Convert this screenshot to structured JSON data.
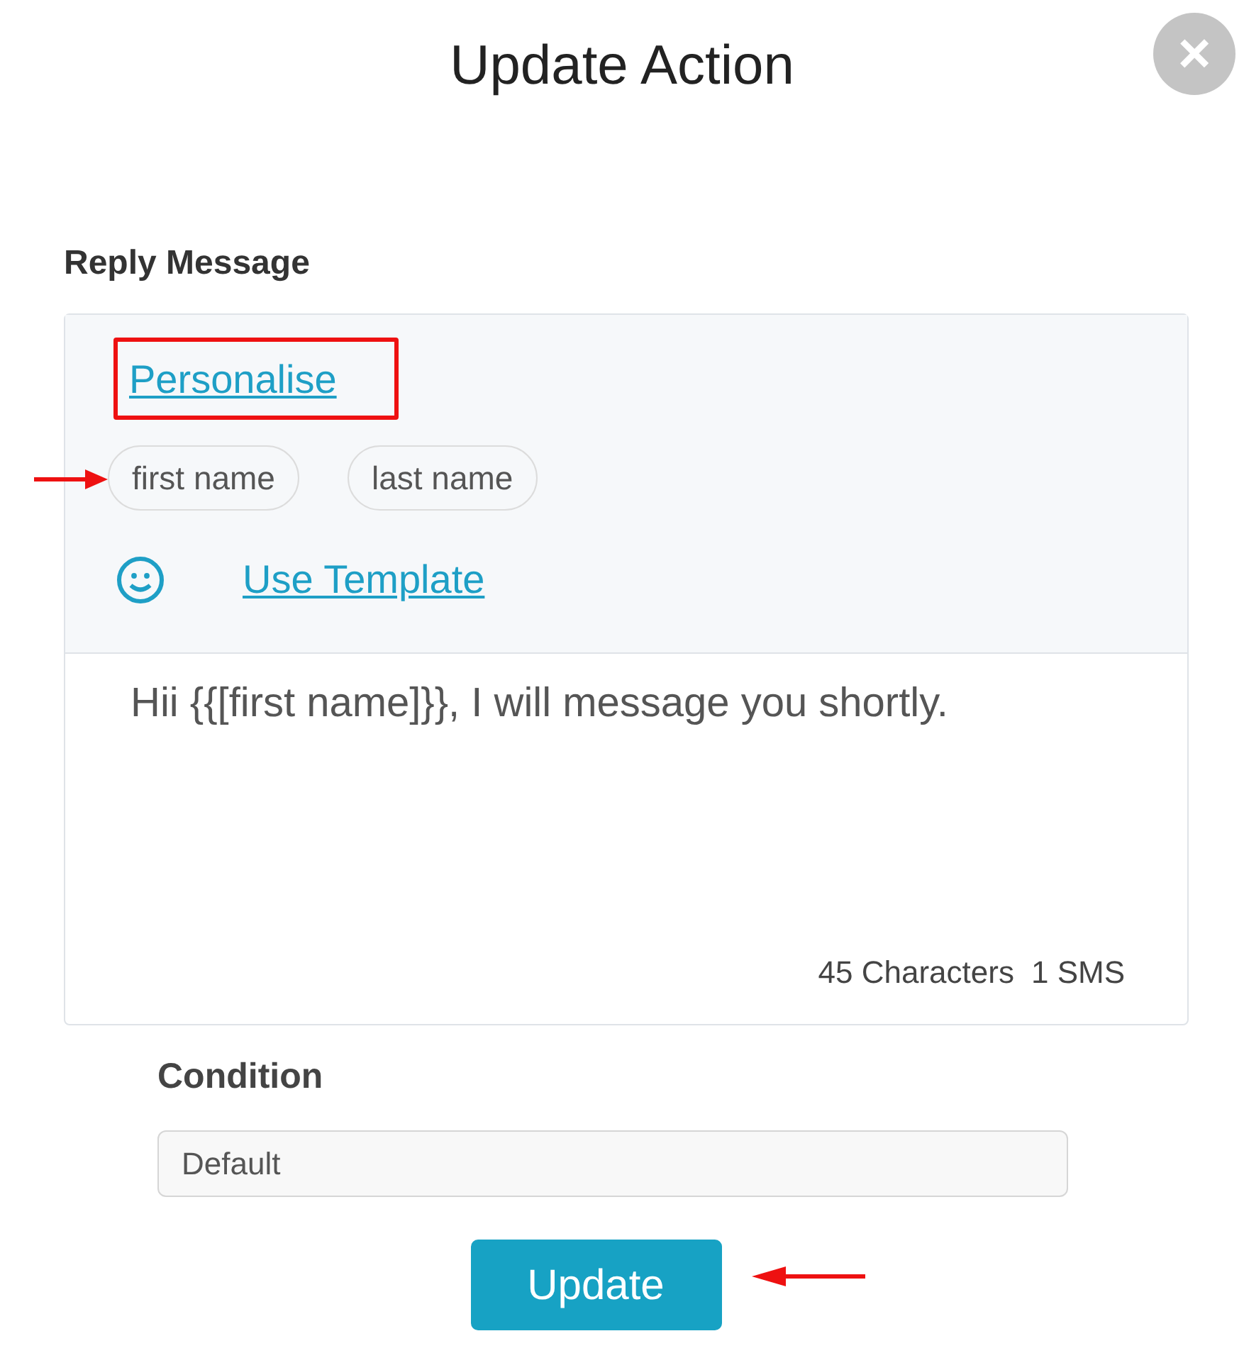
{
  "dialog": {
    "title": "Update Action",
    "close_icon": "×"
  },
  "reply_message": {
    "label": "Reply Message",
    "personalise_link": "Personalise",
    "tags": [
      {
        "label": "first name"
      },
      {
        "label": "last name"
      }
    ],
    "use_template_link": "Use Template",
    "message": "Hii {{[first name]}}, I will message you shortly.",
    "character_count": "45 Characters",
    "sms_count": "1 SMS"
  },
  "condition": {
    "label": "Condition",
    "value": "Default"
  },
  "buttons": [
    {
      "label": "Update"
    }
  ],
  "annotations": [
    {
      "kind": "box"
    },
    {
      "kind": "arrow"
    },
    {
      "kind": "arrow"
    }
  ]
}
